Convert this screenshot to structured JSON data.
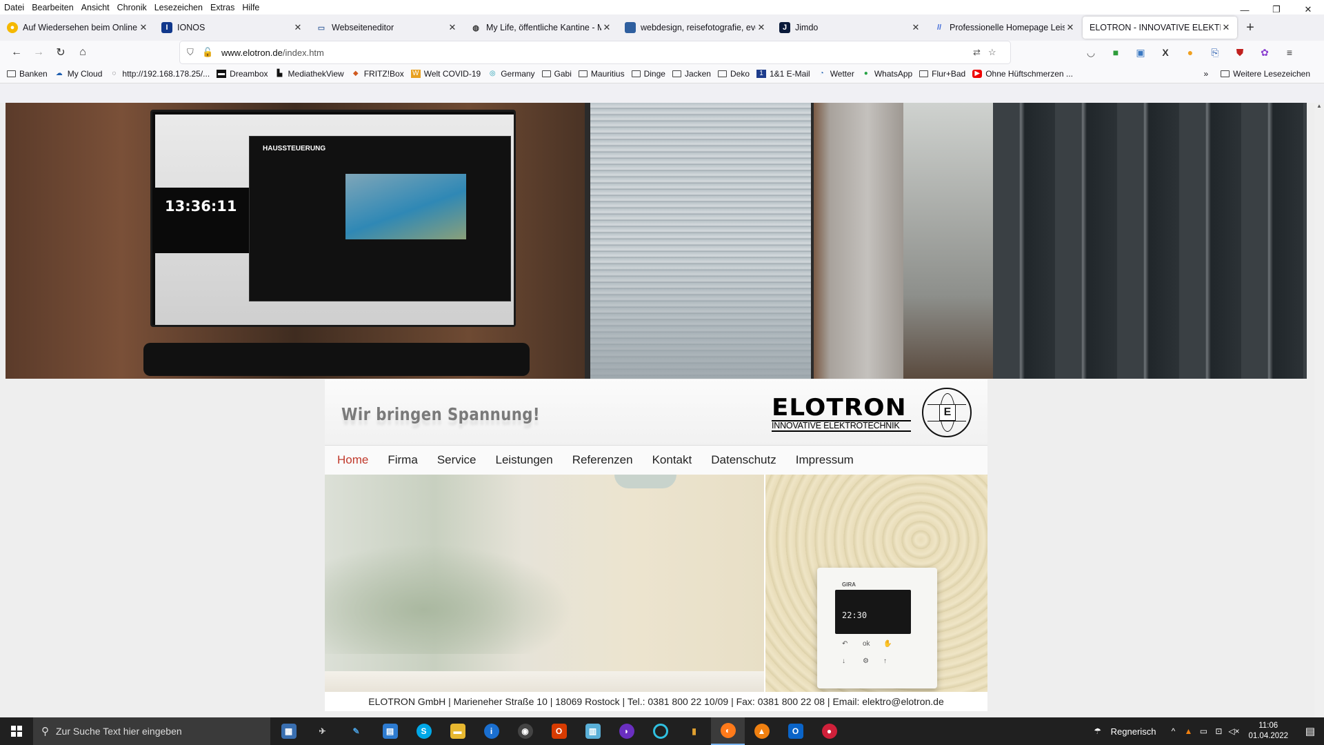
{
  "menu": [
    "Datei",
    "Bearbeiten",
    "Ansicht",
    "Chronik",
    "Lesezeichen",
    "Extras",
    "Hilfe"
  ],
  "tabs": [
    {
      "label": "Auf Wiedersehen beim Online B",
      "icon": "norton-icon",
      "color": "#f5b800"
    },
    {
      "label": "IONOS",
      "icon": "ionos-icon",
      "color": "#11388c"
    },
    {
      "label": "Webseiteneditor",
      "icon": "editor-icon",
      "color": "#4a6fa5"
    },
    {
      "label": "My Life, öffentliche Kantine - M",
      "icon": "globe-icon",
      "color": "#333333"
    },
    {
      "label": "webdesign, reisefotografie, eve",
      "icon": "webdesign-icon",
      "color": "#2f5f9f"
    },
    {
      "label": "Jimdo",
      "icon": "jimdo-icon",
      "color": "#0a1a3a"
    },
    {
      "label": "Professionelle Homepage Leist",
      "icon": "jimdo-logo-icon",
      "color": "#3a66d8"
    },
    {
      "label": "ELOTRON - INNOVATIVE ELEKTROT",
      "icon": "",
      "color": "#ffffff",
      "active": true
    }
  ],
  "url": {
    "domain": "www.elotron.de",
    "path": "/index.htm"
  },
  "bookmarks": [
    {
      "label": "Banken",
      "type": "folder"
    },
    {
      "label": "My Cloud",
      "type": "cloud"
    },
    {
      "label": "http://192.168.178.25/...",
      "type": "link"
    },
    {
      "label": "Dreambox",
      "type": "link"
    },
    {
      "label": "MediathekView",
      "type": "link"
    },
    {
      "label": "FRITZ!Box",
      "type": "link"
    },
    {
      "label": "Welt COVID-19",
      "type": "link"
    },
    {
      "label": "Germany",
      "type": "link"
    },
    {
      "label": "Gabi",
      "type": "folder"
    },
    {
      "label": "Mauritius",
      "type": "folder"
    },
    {
      "label": "Dinge",
      "type": "folder"
    },
    {
      "label": "Jacken",
      "type": "folder"
    },
    {
      "label": "Deko",
      "type": "folder"
    },
    {
      "label": "1&1 E-Mail",
      "type": "link"
    },
    {
      "label": "Wetter",
      "type": "link"
    },
    {
      "label": "WhatsApp",
      "type": "link"
    },
    {
      "label": "Flur+Bad",
      "type": "folder"
    },
    {
      "label": "Ohne Hüftschmerzen ...",
      "type": "youtube"
    }
  ],
  "bookmarks_more": "Weitere Lesezeichen",
  "banner": {
    "tv_title": "HAUSSTEUERUNG",
    "tv_clock": "13:36:11"
  },
  "site": {
    "slogan": "Wir bringen Spannung!",
    "logo_name": "ELOTRON",
    "logo_sub": "INNOVATIVE ELEKTROTECHNIK",
    "emblem_letter": "E",
    "nav": [
      "Home",
      "Firma",
      "Service",
      "Leistungen",
      "Referenzen",
      "Kontakt",
      "Datenschutz",
      "Impressum"
    ],
    "nav_active": "Home",
    "gira_brand": "GIRA",
    "gira_time": "22:30",
    "footer": "ELOTRON GmbH | Marieneher Straße 10 | 18069 Rostock | Tel.: 0381 800 22 10/09 | Fax: 0381 800 22 08 | Email: elektro@elotron.de"
  },
  "taskbar": {
    "search_placeholder": "Zur Suche Text hier eingeben",
    "weather": "Regnerisch",
    "time": "11:06",
    "date": "01.04.2022"
  },
  "colors": {
    "nav_active": "#c0392b",
    "taskbar": "#202020"
  }
}
